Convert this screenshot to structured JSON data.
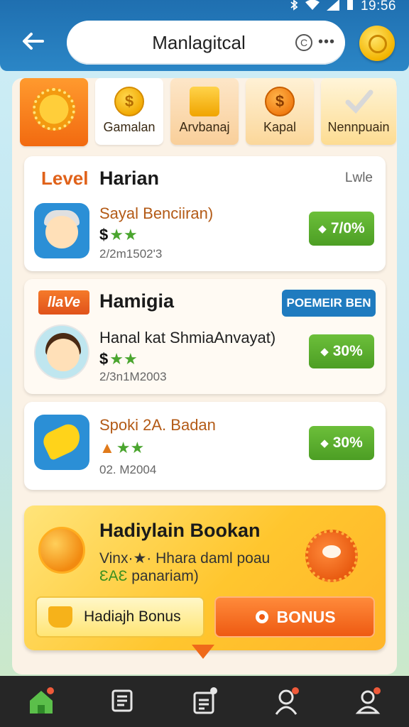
{
  "status_bar": {
    "time": "19:56"
  },
  "header": {
    "title": "Manlagitcal",
    "copyright_glyph": "C",
    "more_glyph": "•••"
  },
  "tabs": [
    {
      "label": "",
      "icon": "sun-badge-icon"
    },
    {
      "label": "Gamalan",
      "icon": "coin-icon"
    },
    {
      "label": "Arvbanaj",
      "icon": "gift-box-icon"
    },
    {
      "label": "Kapal",
      "icon": "orange-coin-icon"
    },
    {
      "label": "Nennpuain",
      "icon": "check-icon"
    }
  ],
  "cards": {
    "level_harian": {
      "tag": "Level",
      "title": "Harian",
      "meta": "Lwle",
      "item_title": "Sayal Benciiran)",
      "stars_prefix": "$",
      "stars": "★★",
      "date": "2/2m1502'3",
      "percent": "7/0%"
    },
    "hamigia": {
      "tag": "llaVe",
      "title": "Hamigia",
      "badge": "POEMEIR BEN",
      "item_title": "Hanal kat ShmiaAnvayat)",
      "stars_prefix": "$",
      "stars": "★★",
      "date": "2/3n1M2003",
      "percent": "30%"
    },
    "spoki": {
      "item_title": "Spoki 2A. Badan",
      "stars_prefix": "▲",
      "stars": "★★",
      "date": "02. M2004",
      "percent": "30%"
    }
  },
  "bonus": {
    "title": "Hadiylain Bookan",
    "sub_line1": "Vinx·★· Hhara daml poau",
    "sub_line2_prefix": "ƐAƐ",
    "sub_line2": " panariam)",
    "left_button": "Hadiajh Bonus",
    "right_button": "BONUS"
  },
  "colors": {
    "header_blue": "#1f6fb0",
    "accent_orange": "#ef5a12",
    "percent_green": "#4c9e24",
    "premium_blue": "#1f7bbf"
  }
}
